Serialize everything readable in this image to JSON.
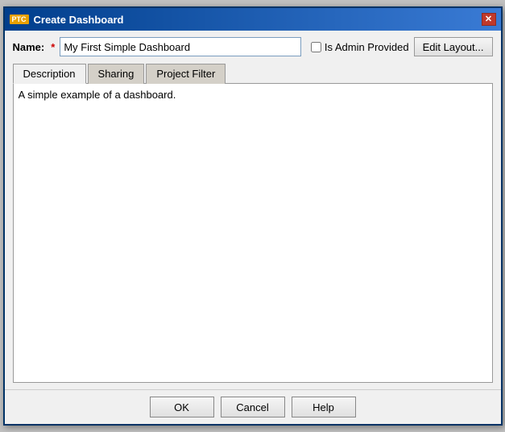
{
  "dialog": {
    "title": "Create Dashboard",
    "logo": "PTC",
    "close_label": "✕"
  },
  "name_row": {
    "label": "Name:",
    "required_star": "★",
    "name_value": "My First Simple Dashboard",
    "admin_label": "Is Admin Provided",
    "edit_layout_label": "Edit Layout..."
  },
  "tabs": {
    "active": 0,
    "items": [
      {
        "label": "Description"
      },
      {
        "label": "Sharing"
      },
      {
        "label": "Project Filter"
      }
    ]
  },
  "description": {
    "value": "A simple example of a dashboard."
  },
  "footer": {
    "ok_label": "OK",
    "cancel_label": "Cancel",
    "help_label": "Help"
  }
}
